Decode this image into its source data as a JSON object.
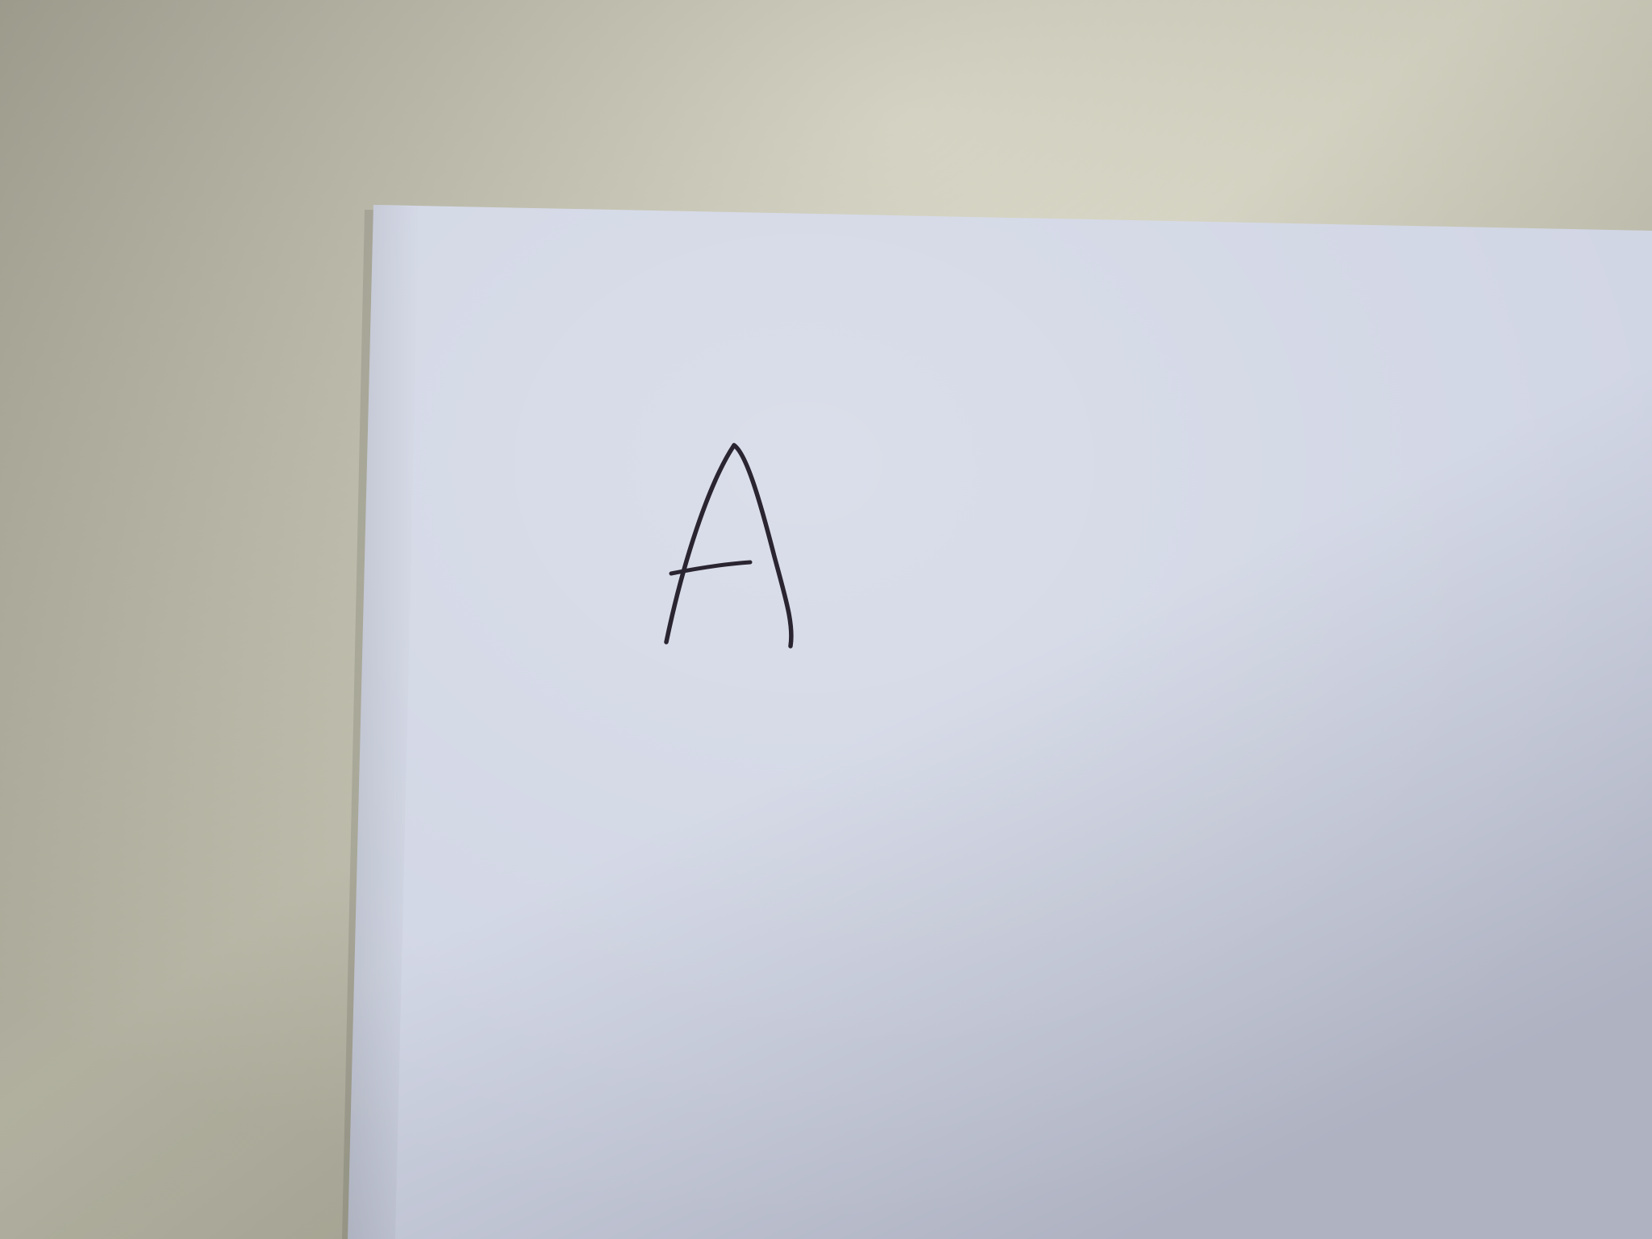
{
  "scene": {
    "handwritten_letter": "A",
    "colors": {
      "wall_light": "#d8d6c2",
      "wall_shadow": "#a9a795",
      "paper_light": "#d0d5e4",
      "paper_shadow": "#aeb2c1",
      "ink": "#2a2530"
    }
  }
}
